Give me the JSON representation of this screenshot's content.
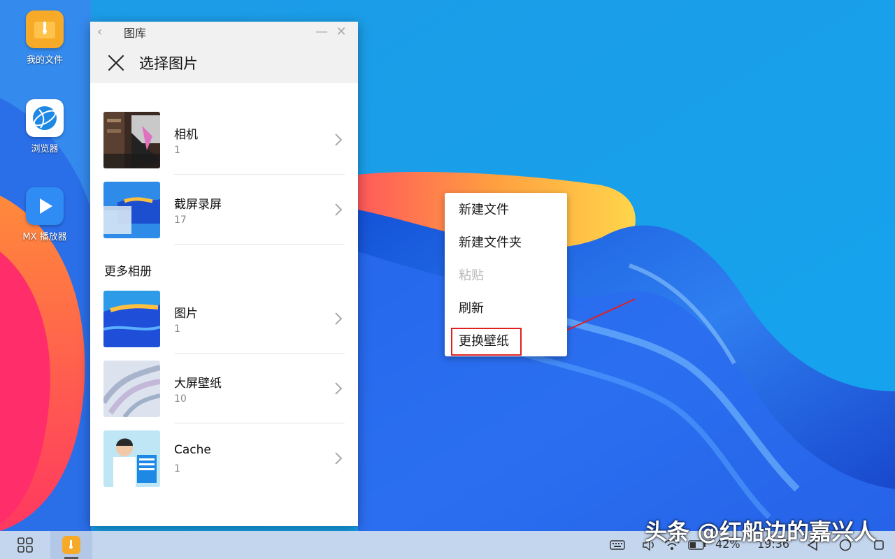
{
  "desktop": {
    "icons": [
      {
        "label": "我的文件",
        "icon": "folder-zip-icon"
      },
      {
        "label": "浏览器",
        "icon": "browser-globe-icon"
      },
      {
        "label": "MX 播放器",
        "icon": "play-icon"
      }
    ]
  },
  "gallery_window": {
    "title": "图库",
    "header": "选择图片",
    "albums_top": [
      {
        "name": "相机",
        "count": "1"
      },
      {
        "name": "截屏录屏",
        "count": "17"
      }
    ],
    "more_section_title": "更多相册",
    "albums_more": [
      {
        "name": "图片",
        "count": "1"
      },
      {
        "name": "大屏壁纸",
        "count": "10"
      },
      {
        "name": "Cache",
        "count": "1"
      }
    ]
  },
  "context_menu": {
    "items": [
      {
        "label": "新建文件",
        "enabled": true
      },
      {
        "label": "新建文件夹",
        "enabled": true
      },
      {
        "label": "粘贴",
        "enabled": false
      },
      {
        "label": "刷新",
        "enabled": true
      },
      {
        "label": "更换壁纸",
        "enabled": true,
        "highlighted": true
      }
    ]
  },
  "taskbar": {
    "battery_percent": "42%",
    "time": "19:36"
  },
  "watermark": "头条 @红船边的嘉兴人",
  "colors": {
    "accent_red": "#e02020",
    "taskbar_bg": "#c4d6ee",
    "folder_orange": "#f7a928"
  }
}
